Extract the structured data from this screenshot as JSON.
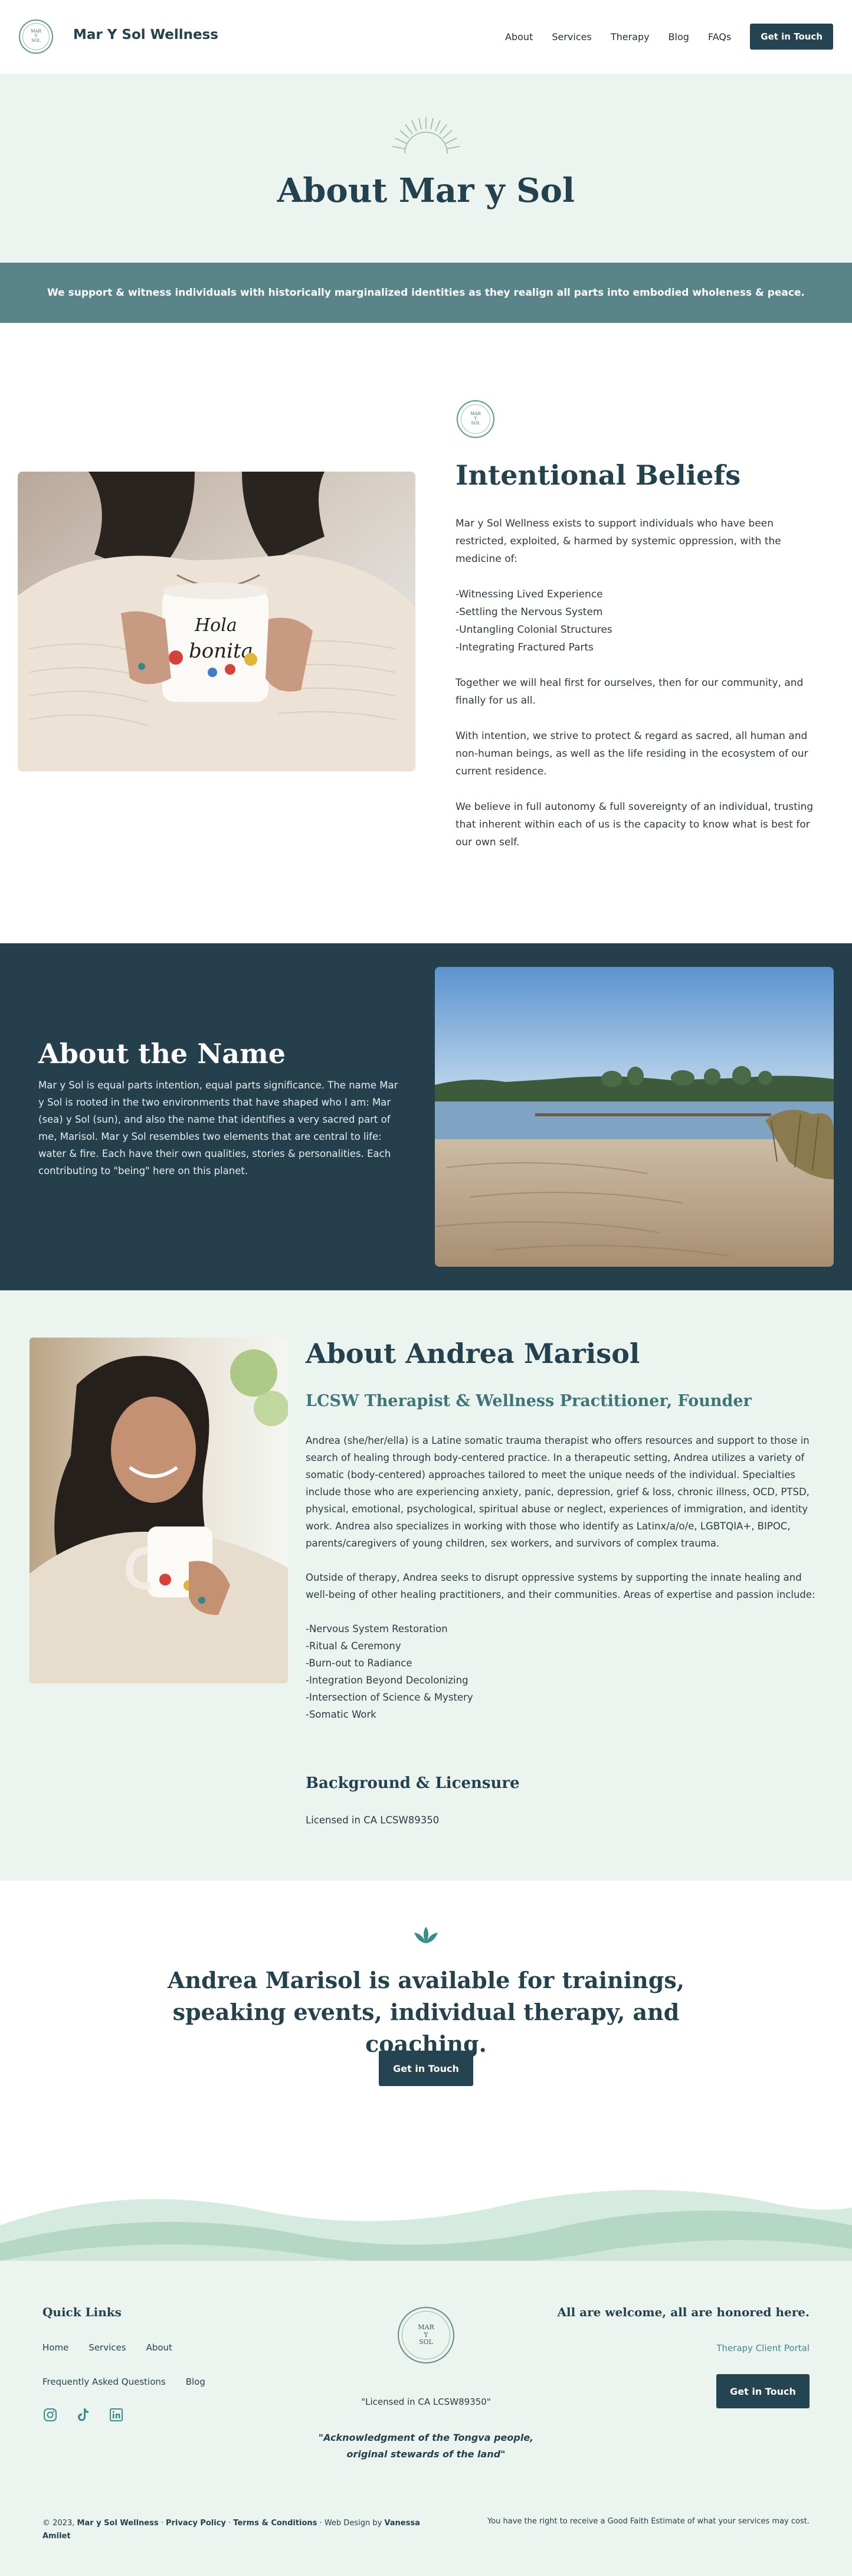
{
  "header": {
    "logo_lines": [
      "MAR",
      "Y",
      "SOL"
    ],
    "brand": "Mar Y Sol Wellness",
    "nav": [
      "About",
      "Services",
      "Therapy",
      "Blog",
      "FAQs"
    ],
    "cta": "Get in Touch"
  },
  "hero": {
    "title": "About Mar y Sol",
    "mission": "We support & witness individuals with historically marginalized identities as they realign all parts into embodied wholeness & peace."
  },
  "beliefs": {
    "badge_lines": [
      "MAR",
      "Y",
      "SOL"
    ],
    "title": "Intentional Beliefs",
    "intro": "Mar y Sol Wellness exists to support individuals who have been restricted, exploited, & harmed by systemic oppression, with the medicine of:",
    "list": [
      "-Witnessing Lived Experience",
      "-Settling the Nervous System",
      "-Untangling Colonial Structures",
      "-Integrating Fractured Parts"
    ],
    "p2": "Together we will heal first for ourselves, then for our community, and finally for us all.",
    "p3": "With intention, we strive to protect & regard as sacred, all human and non-human beings, as well as the life residing in the ecosystem of our current residence.",
    "p4": "We believe in full autonomy & full sovereignty of an individual, trusting that inherent within each of us is the capacity to know what is best for our own self.",
    "mug_text": [
      "Hola",
      "bonita"
    ]
  },
  "name_section": {
    "title": "About the Name",
    "text": "Mar y Sol is equal parts intention, equal parts significance. The name Mar y Sol is rooted in the two environments that have shaped who I am: Mar (sea) y Sol (sun), and also the name that identifies a very sacred part of me, Marisol. Mar y Sol resembles two elements that are central to life: water & fire. Each have their own qualities, stories & personalities. Each contributing to \"being\" here on this planet."
  },
  "andrea": {
    "title": "About Andrea Marisol",
    "subtitle": "LCSW Therapist & Wellness Practitioner, Founder",
    "p1": "Andrea (she/her/ella) is a Latine somatic trauma therapist who offers resources and support to those in search of healing through body-centered practice. In a therapeutic setting, Andrea utilizes a variety of somatic (body-centered) approaches tailored to meet the unique needs of the individual. Specialties include those who are experiencing anxiety, panic, depression, grief & loss, chronic illness, OCD, PTSD, physical, emotional, psychological, spiritual abuse or neglect, experiences of immigration, and identity work. Andrea also specializes in working with those who identify as Latinx/a/o/e, LGBTQIA+, BIPOC, parents/caregivers of young children, sex workers, and survivors of complex trauma.",
    "p2": "Outside of therapy, Andrea seeks to disrupt oppressive systems by supporting the innate healing and well-being of other healing practitioners, and their communities. Areas of expertise and passion include:",
    "list": [
      "-Nervous System Restoration",
      "-Ritual & Ceremony",
      "-Burn-out to Radiance",
      "-Integration Beyond Decolonizing",
      "-Intersection of Science & Mystery",
      "-Somatic Work"
    ],
    "bg_title": "Background & Licensure",
    "bg_text": "Licensed in CA LCSW89350"
  },
  "cta": {
    "title": "Andrea Marisol is available for trainings, speaking events, individual therapy, and coaching.",
    "button": "Get in Touch"
  },
  "footer": {
    "quick_links_title": "Quick Links",
    "links_row1": [
      "Home",
      "Services",
      "About"
    ],
    "links_row2": [
      "Frequently Asked Questions",
      "Blog"
    ],
    "social_icons": [
      "instagram-icon",
      "tiktok-icon",
      "linkedin-icon"
    ],
    "badge_lines": [
      "MAR",
      "Y",
      "SOL"
    ],
    "license": "\"Licensed in CA LCSW89350\"",
    "ack_line1": "\"Acknowledgment of the Tongva people,",
    "ack_line2": "original stewards of the land\"",
    "welcome": "All are welcome, all are honored here.",
    "portal": "Therapy Client Portal",
    "button": "Get in Touch",
    "copyright_prefix": "© 2023,",
    "copyright_brand": "Mar y Sol Wellness",
    "privacy": "Privacy Policy",
    "terms": "Terms & Conditions",
    "design_by": "Web Design by",
    "designer": "Vanessa Amilet",
    "gfe": "You have the right to receive a Good Faith Estimate of what your services may cost."
  },
  "colors": {
    "primary_dark": "#244451",
    "mint_bg": "#ebf4ee",
    "teal_bar": "#58848a",
    "accent_teal": "#3d8a8f"
  }
}
